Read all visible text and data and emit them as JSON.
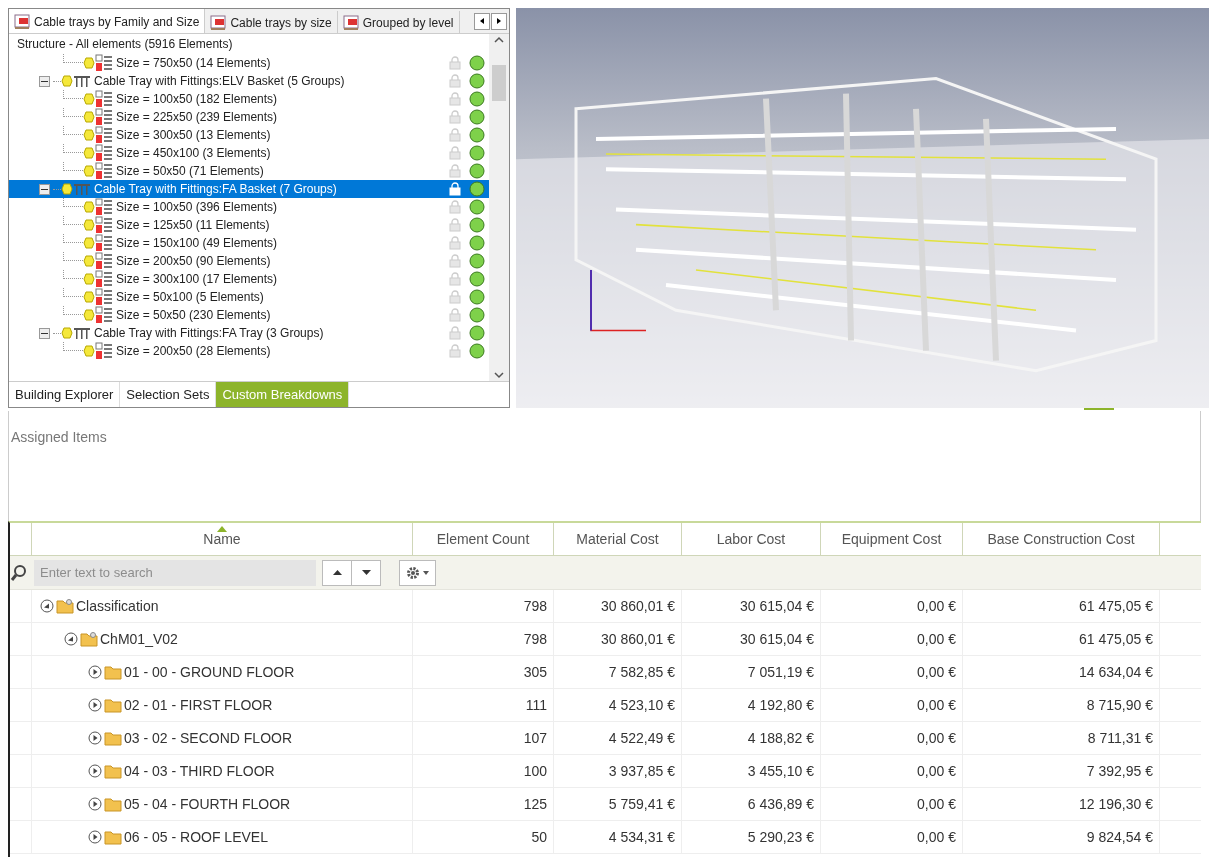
{
  "top_tabs": [
    {
      "label": "Cable trays by Family and Size",
      "selected": true
    },
    {
      "label": "Cable trays by size",
      "selected": false
    },
    {
      "label": "Grouped by level",
      "selected": false
    }
  ],
  "tree": {
    "header": "Structure - All elements (5916 Elements)",
    "groups": [
      {
        "children": [
          {
            "label": "Size = 750x50 (14 Elements)",
            "selected": false
          }
        ]
      },
      {
        "label": "Cable Tray with Fittings:ELV Basket (5 Groups)",
        "expanded": true,
        "selected": false,
        "children": [
          {
            "label": "Size = 100x50 (182 Elements)",
            "selected": false
          },
          {
            "label": "Size = 225x50 (239 Elements)",
            "selected": false
          },
          {
            "label": "Size = 300x50 (13 Elements)",
            "selected": false
          },
          {
            "label": "Size = 450x100 (3 Elements)",
            "selected": false
          },
          {
            "label": "Size = 50x50 (71 Elements)",
            "selected": false
          }
        ]
      },
      {
        "label": "Cable Tray with Fittings:FA Basket (7 Groups)",
        "expanded": true,
        "selected": true,
        "children": [
          {
            "label": "Size = 100x50 (396 Elements)",
            "selected": false
          },
          {
            "label": "Size = 125x50 (11 Elements)",
            "selected": false
          },
          {
            "label": "Size = 150x100 (49 Elements)",
            "selected": false
          },
          {
            "label": "Size = 200x50 (90 Elements)",
            "selected": false
          },
          {
            "label": "Size = 300x100 (17 Elements)",
            "selected": false
          },
          {
            "label": "Size = 50x100 (5 Elements)",
            "selected": false
          },
          {
            "label": "Size = 50x50 (230 Elements)",
            "selected": false
          }
        ]
      },
      {
        "label": "Cable Tray with Fittings:FA Tray (3 Groups)",
        "expanded": true,
        "selected": false,
        "children": [
          {
            "label": "Size = 200x50 (28 Elements)",
            "selected": false
          }
        ]
      }
    ]
  },
  "bottom_tabs": [
    {
      "label": "Building Explorer",
      "selected": false
    },
    {
      "label": "Selection Sets",
      "selected": false
    },
    {
      "label": "Custom Breakdowns",
      "selected": true
    }
  ],
  "assigned_title": "Assigned Items",
  "table": {
    "columns": [
      "Name",
      "Element Count",
      "Material Cost",
      "Labor Cost",
      "Equipment Cost",
      "Base Construction Cost"
    ],
    "search": {
      "placeholder": "Enter text to search"
    },
    "rows": [
      {
        "expanded": true,
        "cells": [
          "Classification",
          "798",
          "30 860,01 €",
          "30 615,04 €",
          "0,00 €",
          "61 475,05 €"
        ],
        "children": [
          {
            "expanded": true,
            "cells": [
              "ChM01_V02",
              "798",
              "30 860,01 €",
              "30 615,04 €",
              "0,00 €",
              "61 475,05 €"
            ],
            "children": [
              {
                "expanded": false,
                "cells": [
                  "01 - 00 - GROUND FLOOR",
                  "305",
                  "7 582,85 €",
                  "7 051,19 €",
                  "0,00 €",
                  "14 634,04 €"
                ]
              },
              {
                "expanded": false,
                "cells": [
                  "02 - 01 - FIRST FLOOR",
                  "111",
                  "4 523,10 €",
                  "4 192,80 €",
                  "0,00 €",
                  "8 715,90 €"
                ]
              },
              {
                "expanded": false,
                "cells": [
                  "03 - 02 - SECOND FLOOR",
                  "107",
                  "4 522,49 €",
                  "4 188,82 €",
                  "0,00 €",
                  "8 711,31 €"
                ]
              },
              {
                "expanded": false,
                "cells": [
                  "04 - 03 - THIRD FLOOR",
                  "100",
                  "3 937,85 €",
                  "3 455,10 €",
                  "0,00 €",
                  "7 392,95 €"
                ]
              },
              {
                "expanded": false,
                "cells": [
                  "05 - 04 - FOURTH FLOOR",
                  "125",
                  "5 759,41 €",
                  "6 436,89 €",
                  "0,00 €",
                  "12 196,30 €"
                ]
              },
              {
                "expanded": false,
                "cells": [
                  "06 - 05 - ROOF LEVEL",
                  "50",
                  "4 534,31 €",
                  "5 290,23 €",
                  "0,00 €",
                  "9 824,54 €"
                ]
              }
            ]
          }
        ]
      }
    ]
  }
}
